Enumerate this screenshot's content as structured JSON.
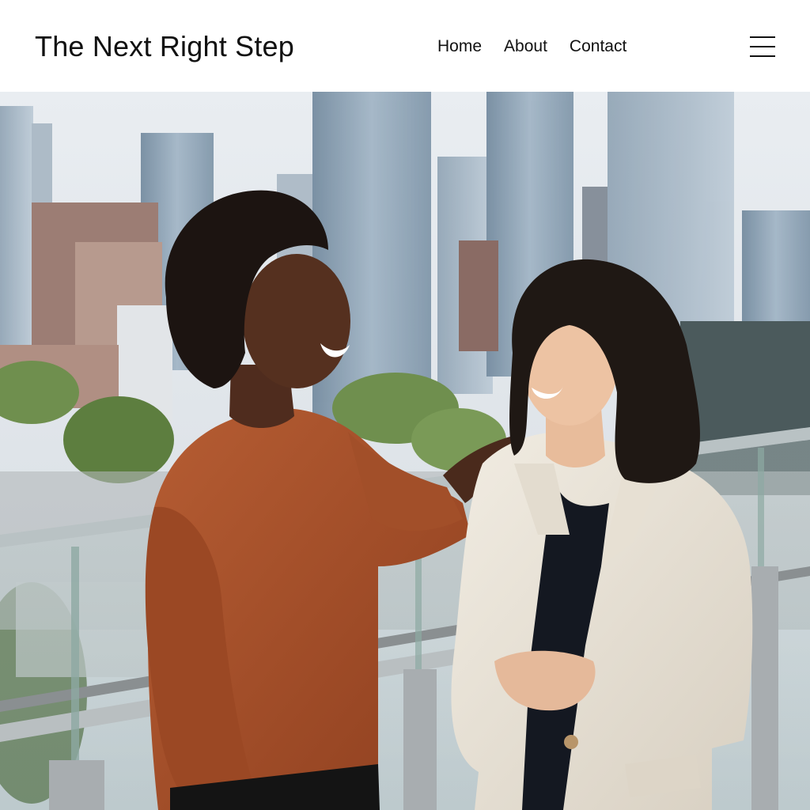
{
  "header": {
    "site_title": "The Next Right Step",
    "nav": [
      {
        "label": "Home"
      },
      {
        "label": "About"
      },
      {
        "label": "Contact"
      }
    ],
    "menu_icon": "hamburger-menu-icon"
  },
  "hero": {
    "image_subject": "two-women-laughing-on-rooftop-balcony",
    "colors": {
      "sky": "#e6ebf0",
      "sweater": "#a8512c",
      "blazer": "#ece6da"
    }
  }
}
